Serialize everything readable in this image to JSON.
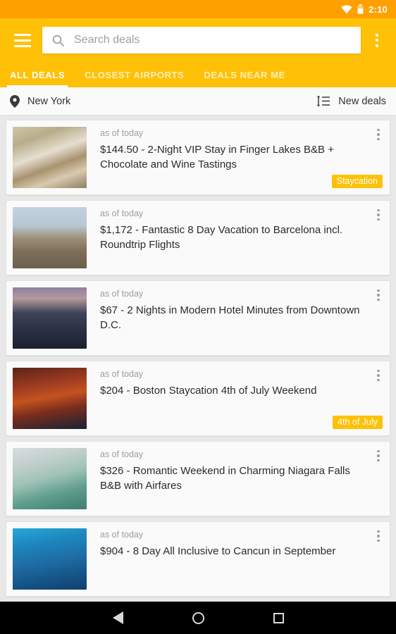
{
  "statusbar": {
    "time": "2:10",
    "wifi_icon": "wifi-icon",
    "battery_icon": "battery-icon"
  },
  "appbar": {
    "menu_icon": "hamburger-menu-icon",
    "overflow_icon": "overflow-menu-icon",
    "search_icon": "search-icon",
    "search_placeholder": "Search deals",
    "search_value": "",
    "background_color": "#FFC107"
  },
  "tabs": [
    {
      "label": "ALL DEALS",
      "active": true
    },
    {
      "label": "CLOSEST AIRPORTS",
      "active": false
    },
    {
      "label": "DEALS NEAR ME",
      "active": false
    }
  ],
  "locationbar": {
    "pin_icon": "location-pin-icon",
    "location": "New York",
    "sort_icon": "sort-icon",
    "sort_label": "New deals"
  },
  "deals": [
    {
      "timestamp": "as of today",
      "title": "$144.50 - 2-Night VIP Stay in Finger Lakes B&B + Chocolate and Wine Tastings",
      "badge": "Staycation",
      "badge_color": "#FFC107",
      "thumb_alt": "bedroom-photo",
      "thumb_css": "linear-gradient(160deg,#cfc7a8 0%,#b8ad8a 22%,#e6ded0 44%,#a8936f 62%,#d8c9b0 78%,#8e7f62 100%)"
    },
    {
      "timestamp": "as of today",
      "title": "$1,172 - Fantastic 8 Day Vacation to Barcelona incl. Roundtrip Flights",
      "badge": "",
      "badge_color": "#FFC107",
      "thumb_alt": "sagrada-familia-photo",
      "thumb_css": "linear-gradient(180deg,#c2d2e0 0%,#b9c6d4 30%,#9c8d74 52%,#7d6f5a 72%,#6b5f4c 100%)"
    },
    {
      "timestamp": "as of today",
      "title": "$67 - 2 Nights in Modern Hotel Minutes from Downtown D.C.",
      "badge": "",
      "badge_color": "#FFC107",
      "thumb_alt": "us-capitol-photo",
      "thumb_css": "linear-gradient(180deg,#8f7fa0 0%,#b49a9e 18%,#3e4258 42%,#2a3044 70%,#1b2030 100%)"
    },
    {
      "timestamp": "as of today",
      "title": "$204 - Boston Staycation 4th of July Weekend",
      "badge": "4th of July",
      "badge_color": "#FFC107",
      "thumb_alt": "fireworks-flag-photo",
      "thumb_css": "linear-gradient(170deg,#5a2418 0%,#9b3a20 28%,#c4521f 48%,#7a2d1c 68%,#1a2236 100%)"
    },
    {
      "timestamp": "as of today",
      "title": "$326 - Romantic Weekend in Charming Niagara Falls B&B with Airfares",
      "badge": "",
      "badge_color": "#FFC107",
      "thumb_alt": "niagara-falls-photo",
      "thumb_css": "linear-gradient(165deg,#d7dde0 0%,#c2cfcb 25%,#9fc3b6 48%,#5e9c8c 72%,#3f7f70 100%)"
    },
    {
      "timestamp": "as of today",
      "title": "$904 - 8 Day All Inclusive to Cancun in September",
      "badge": "",
      "badge_color": "#FFC107",
      "thumb_alt": "snorkeling-reef-photo",
      "thumb_css": "linear-gradient(170deg,#27a8d8 0%,#1d86bd 26%,#1f6fa8 50%,#17588c 74%,#0f3f6c 100%)"
    }
  ],
  "navbar": {
    "back_icon": "back-triangle-icon",
    "home_icon": "home-circle-icon",
    "recents_icon": "recents-square-icon"
  }
}
